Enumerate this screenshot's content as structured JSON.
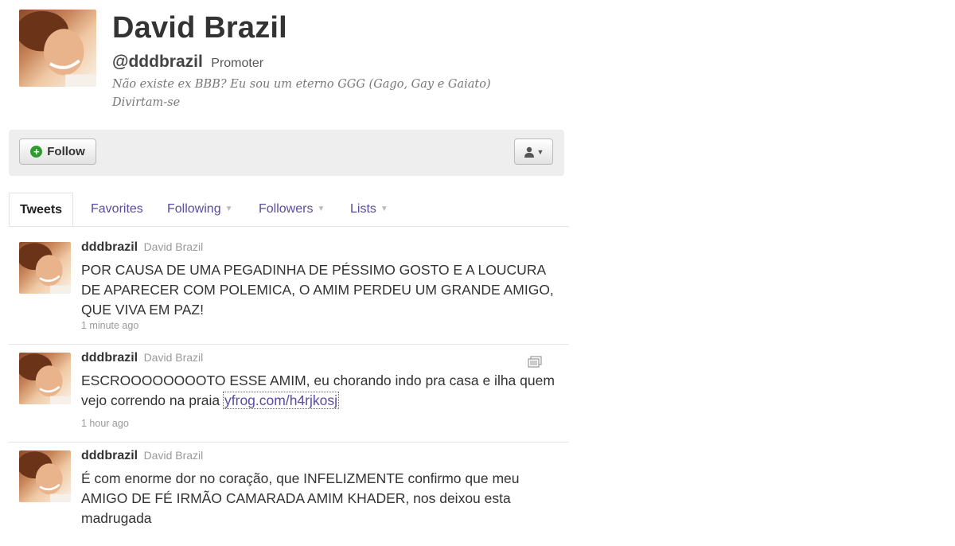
{
  "profile": {
    "name": "David Brazil",
    "screen_name": "@dddbrazil",
    "role": "Promoter",
    "bio": "Não existe ex BBB? Eu sou um eterno GGG (Gago, Gay e Gaiato) Divirtam-se"
  },
  "actions": {
    "follow_label": "Follow",
    "follow_icon": "plus-circle-icon",
    "user_menu_icon": "person-icon"
  },
  "tabs": [
    {
      "label": "Tweets"
    },
    {
      "label": "Favorites"
    },
    {
      "label": "Following"
    },
    {
      "label": "Followers"
    },
    {
      "label": "Lists"
    }
  ],
  "tweets": [
    {
      "user": "dddbrazil",
      "full_name": "David Brazil",
      "text": "POR CAUSA DE UMA PEGADINHA DE PÉSSIMO GOSTO E A LOUCURA DE APARECER COM POLEMICA, O AMIM PERDEU UM GRANDE AMIGO, QUE VIVA EM PAZ!",
      "time": "1 minute ago"
    },
    {
      "user": "dddbrazil",
      "full_name": "David Brazil",
      "text": "ESCROOOOOOOOTO ESSE AMIM, eu chorando indo pra casa e ilha quem vejo correndo na praia ",
      "link": "yfrog.com/h4rjkosj",
      "time": "1 hour ago"
    },
    {
      "user": "dddbrazil",
      "full_name": "David Brazil",
      "text": "É com enorme dor no coração, que INFELIZMENTE confirmo que meu AMIGO DE FÉ IRMÃO CAMARADA AMIM KHADER, nos deixou esta madrugada"
    }
  ],
  "colors": {
    "link": "#5a4ba0",
    "follow_green": "#2f9a2f",
    "bar_bg": "#eeeeee"
  }
}
